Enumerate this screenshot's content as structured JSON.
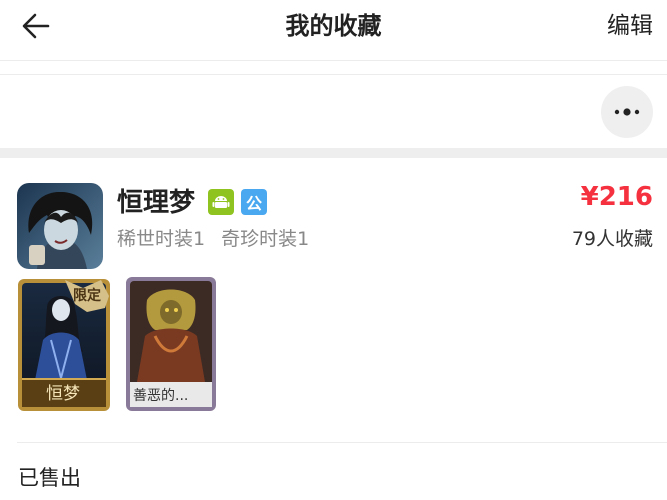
{
  "header": {
    "title": "我的收藏",
    "edit_label": "编辑"
  },
  "listing": {
    "name": "恒理梦",
    "badges": {
      "android": "",
      "public": "公"
    },
    "tags": [
      "稀世时装1",
      "奇珍时装1"
    ],
    "price": "¥216",
    "favorites": "79人收藏",
    "cards": [
      {
        "title": "恒梦",
        "ribbon": "限定"
      },
      {
        "title": "善恶的..."
      }
    ]
  },
  "section": {
    "sold_label": "已售出"
  },
  "colors": {
    "price": "#f5313f",
    "android_badge": "#8fc31f",
    "public_badge": "#4aa8f0"
  },
  "icons": {
    "back": "arrow-left-icon",
    "more": "more-dots-icon",
    "android": "android-icon"
  }
}
